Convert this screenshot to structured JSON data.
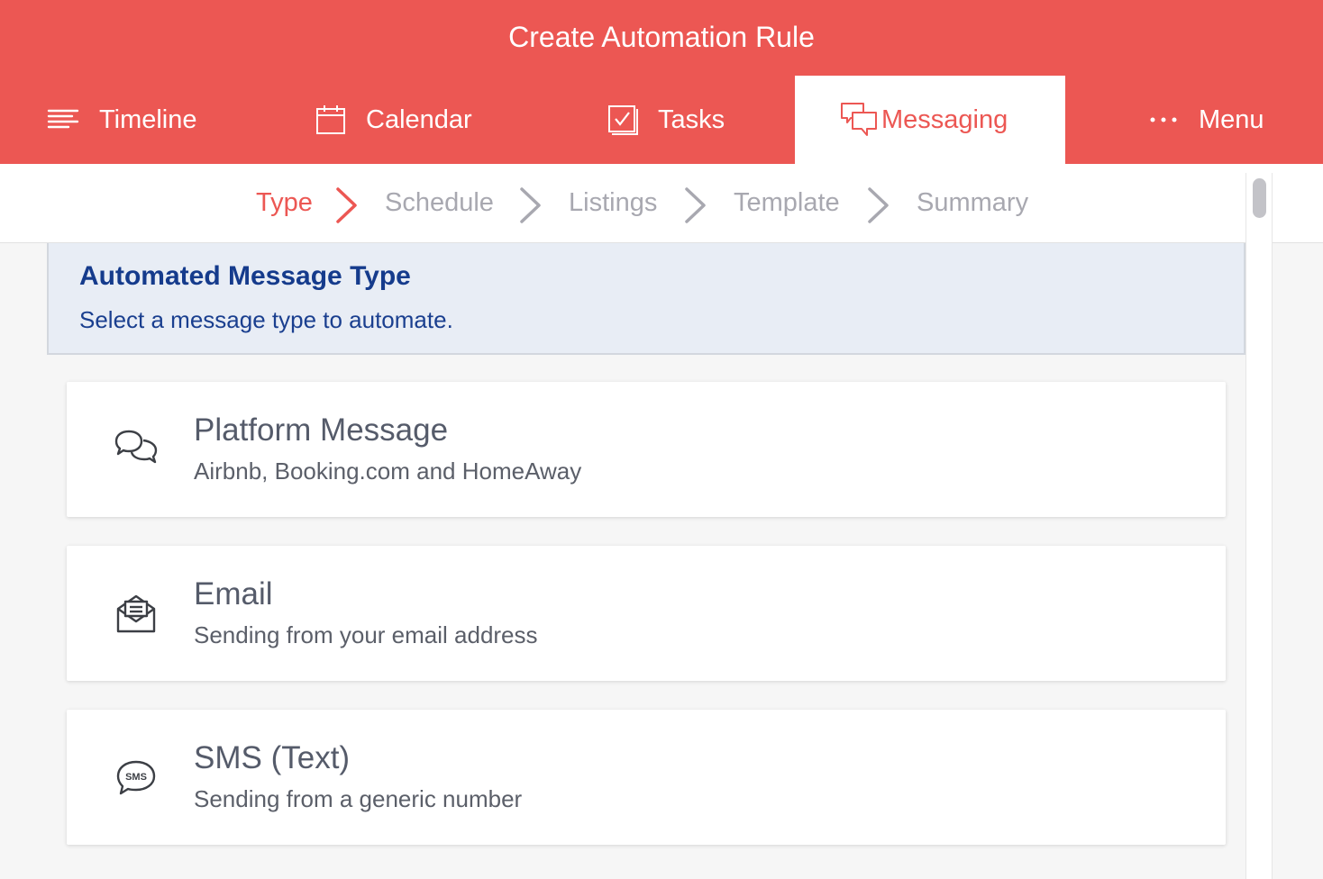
{
  "header": {
    "title": "Create Automation Rule"
  },
  "nav": {
    "timeline": "Timeline",
    "calendar": "Calendar",
    "tasks": "Tasks",
    "messaging": "Messaging",
    "menu": "Menu"
  },
  "steps": {
    "type": "Type",
    "schedule": "Schedule",
    "listings": "Listings",
    "template": "Template",
    "summary": "Summary"
  },
  "panel": {
    "title": "Automated Message Type",
    "subtitle": "Select a message type to automate."
  },
  "options": [
    {
      "title": "Platform Message",
      "subtitle": "Airbnb, Booking.com and HomeAway",
      "icon": "chat-bubbles-icon"
    },
    {
      "title": "Email",
      "subtitle": "Sending from your email address",
      "icon": "envelope-icon"
    },
    {
      "title": "SMS (Text)",
      "subtitle": "Sending from a generic number",
      "icon": "sms-bubble-icon"
    }
  ],
  "colors": {
    "brand": "#ec5753",
    "panel_title": "#153b8c",
    "muted": "#a8a8b0"
  }
}
